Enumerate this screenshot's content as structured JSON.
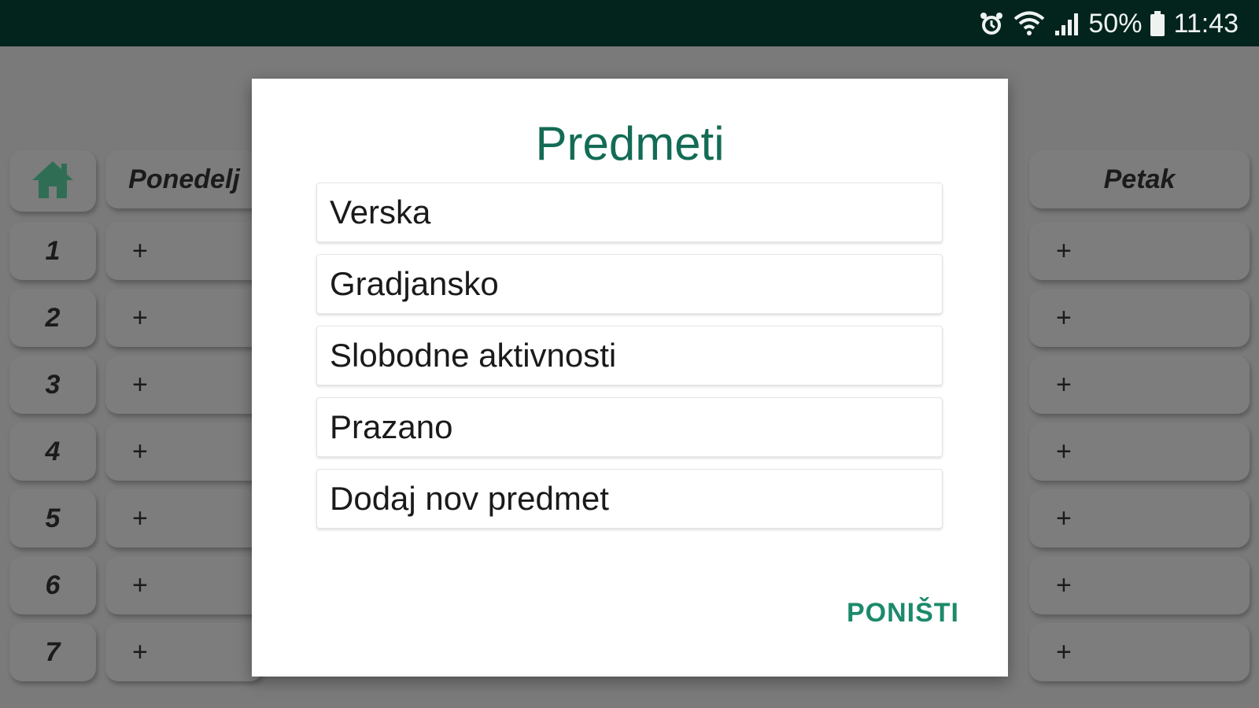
{
  "status_bar": {
    "battery_percent": "50%",
    "time": "11:43",
    "icons": [
      "alarm-icon",
      "wifi-icon",
      "signal-icon",
      "battery-icon"
    ]
  },
  "timetable": {
    "days_visible": [
      "Ponedelj",
      "Petak"
    ],
    "periods": [
      "1",
      "2",
      "3",
      "4",
      "5",
      "6",
      "7"
    ],
    "slot_label": "+"
  },
  "dialog": {
    "title": "Predmeti",
    "options": [
      "Verska",
      "Gradjansko",
      "Slobodne aktivnosti",
      "Prazano",
      "Dodaj nov predmet"
    ],
    "cancel_label": "PONIŠTI"
  },
  "colors": {
    "status_bar_bg": "#03241d",
    "accent": "#136b55",
    "cancel_text": "#1b8a6b",
    "home_icon": "#2f6e55"
  }
}
